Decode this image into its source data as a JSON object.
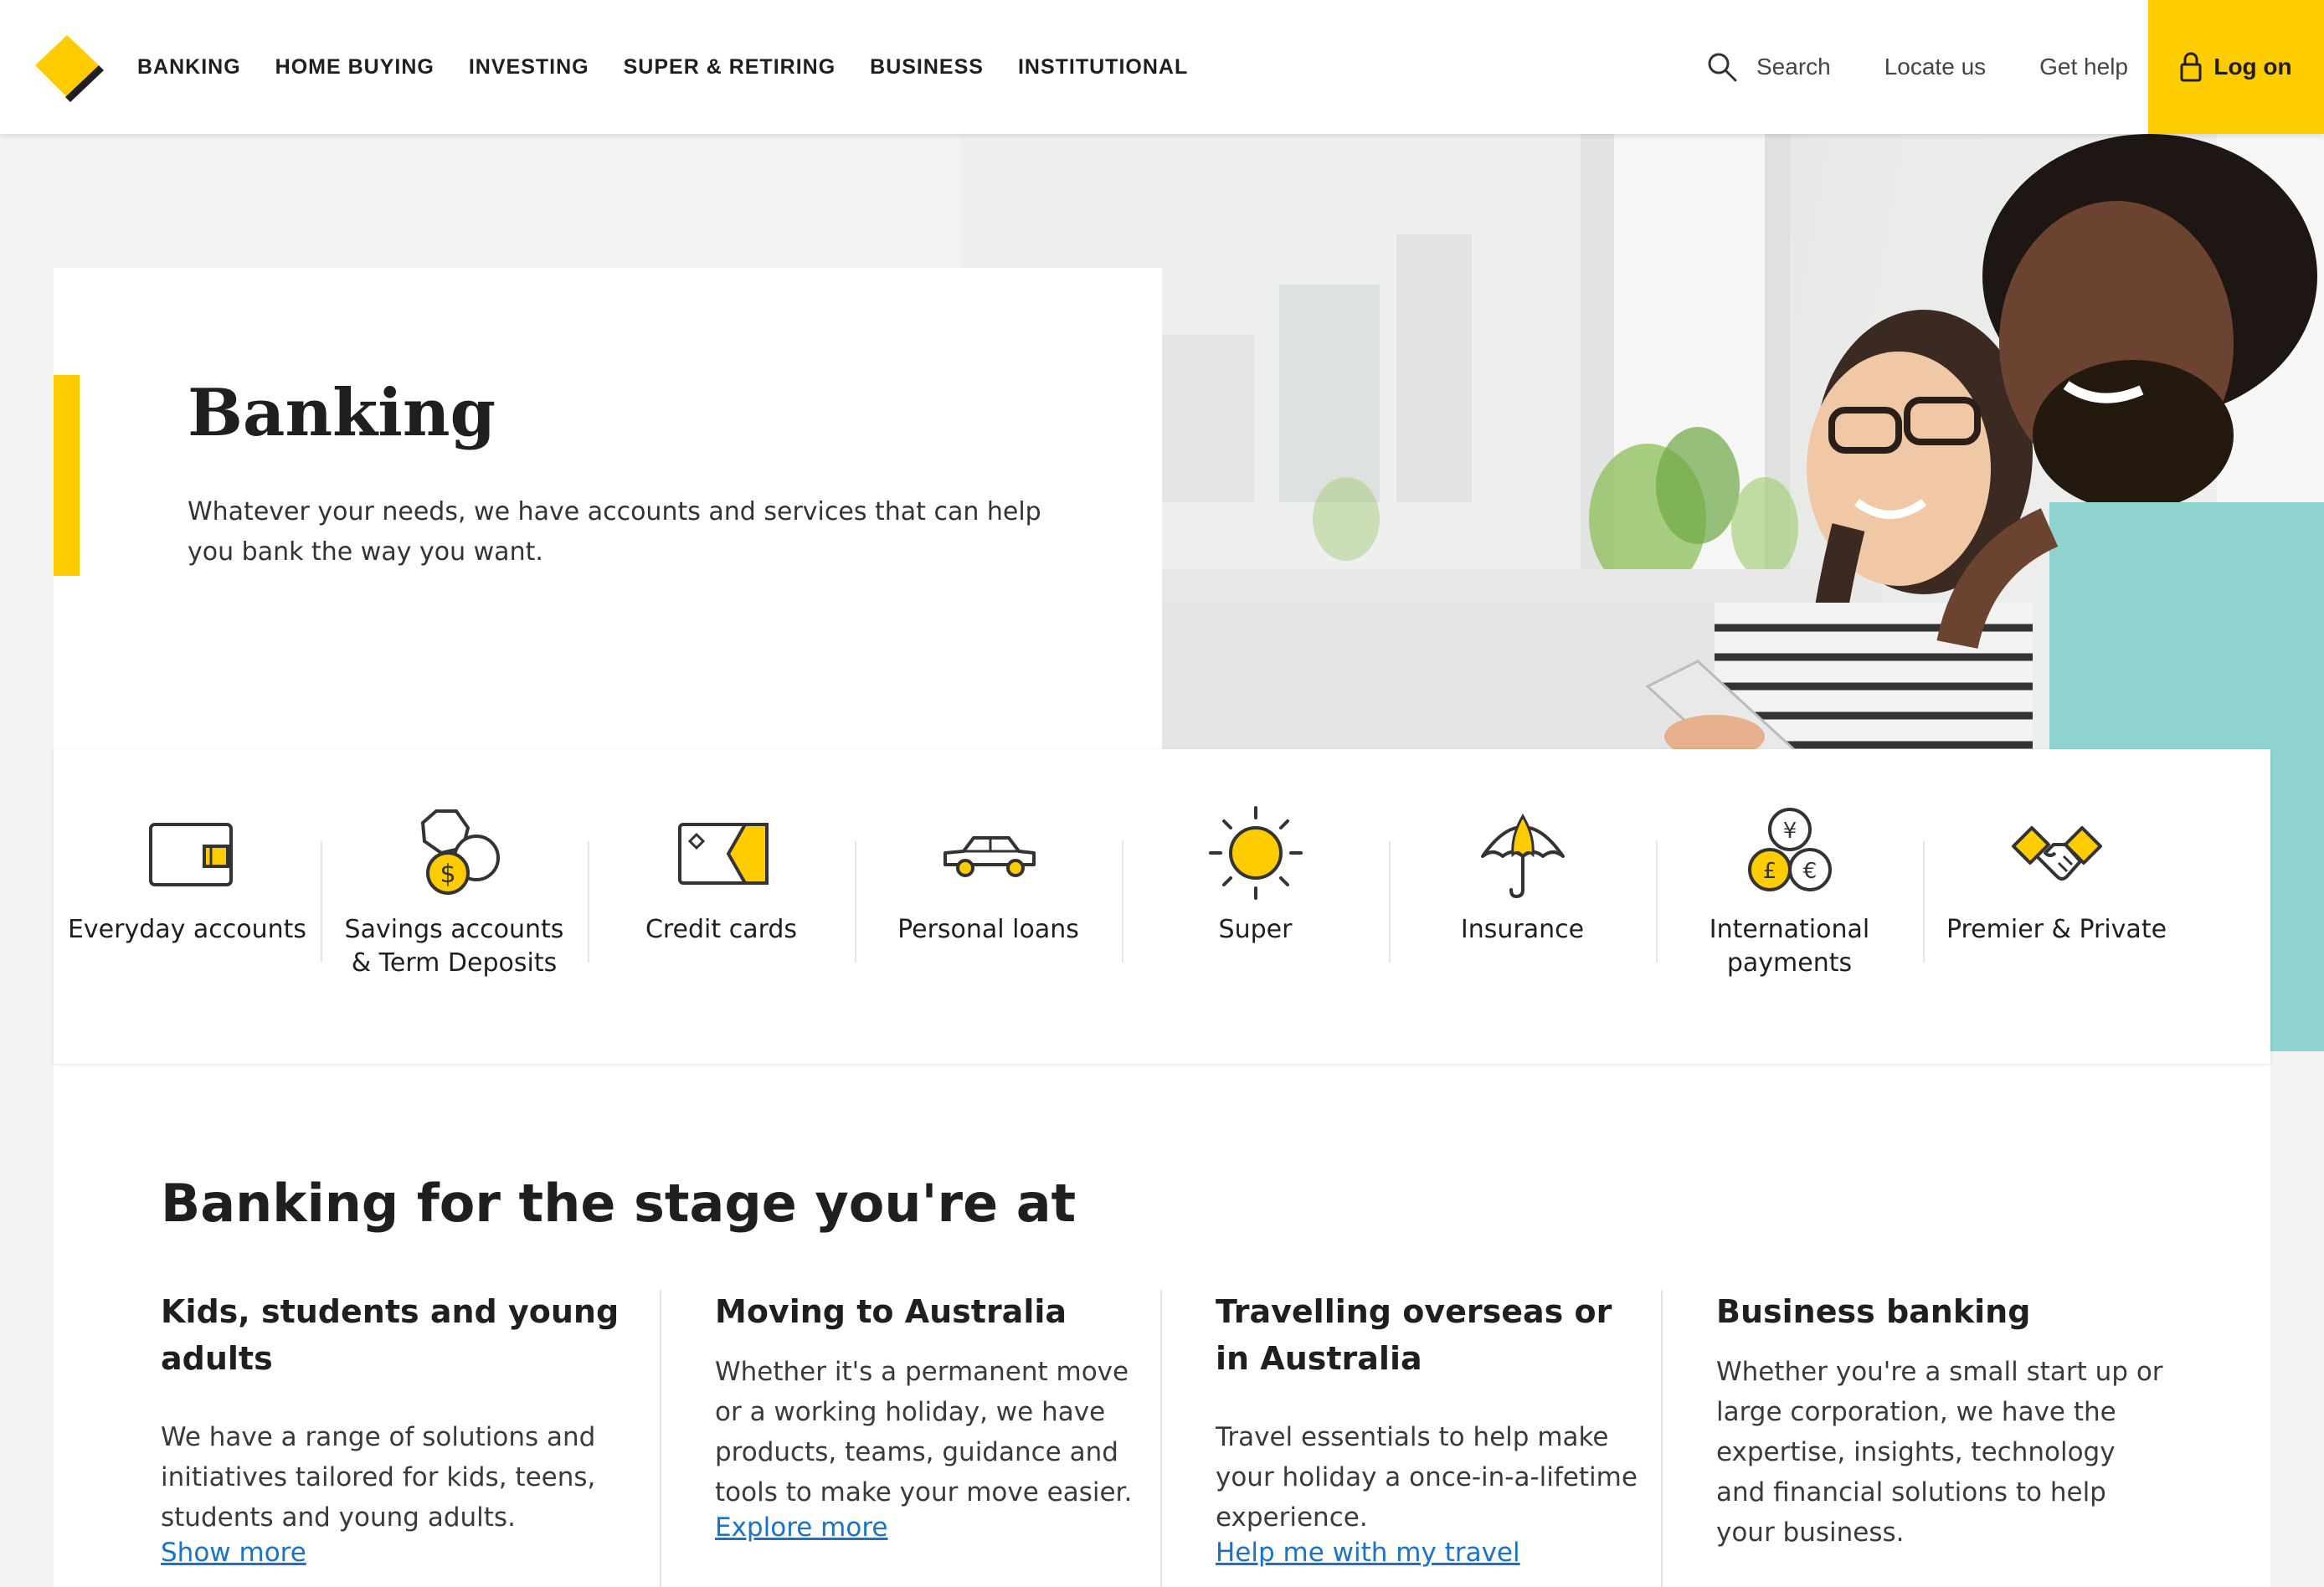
{
  "header": {
    "nav": [
      "BANKING",
      "HOME BUYING",
      "INVESTING",
      "SUPER & RETIRING",
      "BUSINESS",
      "INSTITUTIONAL"
    ],
    "search_label": "Search",
    "locate_label": "Locate us",
    "help_label": "Get help",
    "logon_label": "Log on"
  },
  "hero": {
    "title": "Banking",
    "description": "Whatever your needs, we have accounts and services that can help you bank the way you want."
  },
  "quick_links": [
    {
      "label": "Everyday accounts",
      "icon": "wallet-icon"
    },
    {
      "label": "Savings accounts & Term Deposits",
      "icon": "savings-coins-icon"
    },
    {
      "label": "Credit cards",
      "icon": "credit-card-icon"
    },
    {
      "label": "Personal loans",
      "icon": "car-icon"
    },
    {
      "label": "Super",
      "icon": "sun-icon"
    },
    {
      "label": "Insurance",
      "icon": "umbrella-icon"
    },
    {
      "label": "International payments",
      "icon": "currency-coins-icon"
    },
    {
      "label": "Premier & Private",
      "icon": "handshake-icon"
    }
  ],
  "stage": {
    "title": "Banking for the stage you're at",
    "columns": [
      {
        "title": "Kids, students and young adults",
        "body": "We have a range of solutions and initiatives tailored for kids, teens, students and young adults.",
        "link": "Show more"
      },
      {
        "title": "Moving to Australia",
        "body": "Whether it's a permanent move or a working holiday, we have products, teams, guidance and tools to make your move easier.",
        "link": "Explore more"
      },
      {
        "title": "Travelling overseas or in Australia",
        "body": "Travel essentials to help make your holiday a once-in-a-lifetime experience.",
        "link": "Help me with my travel"
      },
      {
        "title": "Business banking",
        "body": "Whether you're a small start up or large corporation, we have the expertise, insights, technology and financial solutions to help your business.",
        "link": ""
      }
    ]
  },
  "colors": {
    "brand_yellow": "#ffcc00",
    "text": "#1f1f1f",
    "link": "#1a73c8"
  }
}
